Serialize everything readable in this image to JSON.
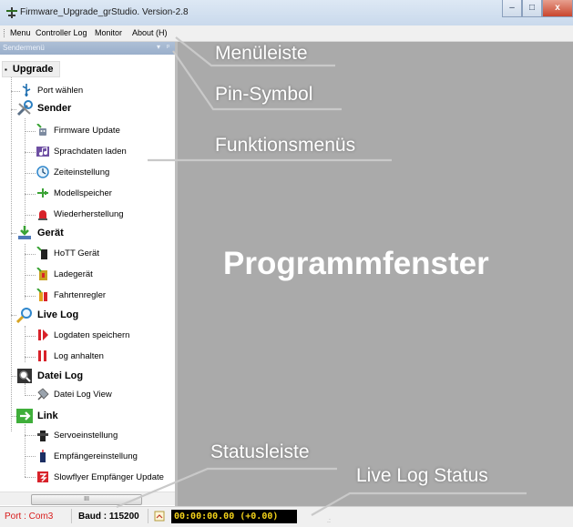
{
  "window": {
    "title": "Firmware_Upgrade_grStudio.  Version-2.8",
    "buttons": {
      "minimize": "‒",
      "maximize": "□",
      "close": "x"
    }
  },
  "menu": {
    "items": [
      "Menu",
      "Controller Log",
      "Monitor",
      "About (H)"
    ]
  },
  "panel": {
    "title": "Sendermenü",
    "dropdown_icon": "▾",
    "pin_icon": "ᵖ"
  },
  "tree": {
    "root": "Upgrade",
    "port": "Port wählen",
    "sender": {
      "label": "Sender",
      "children": [
        "Firmware Update",
        "Sprachdaten laden",
        "Zeiteinstellung",
        "Modellspeicher",
        "Wiederherstellung"
      ]
    },
    "geraet": {
      "label": "Gerät",
      "children": [
        "HoTT Gerät",
        "Ladegerät",
        "Fahrtenregler"
      ]
    },
    "livelog": {
      "label": "Live Log",
      "children": [
        "Logdaten speichern",
        "Log anhalten"
      ]
    },
    "dateilog": {
      "label": "Datei Log",
      "children": [
        "Datei Log View"
      ]
    },
    "link": {
      "label": "Link",
      "children": [
        "Servoeinstellung",
        "Empfängereinstellung",
        "Slowflyer Empfänger Update"
      ]
    }
  },
  "scrollbar": {
    "thumb_label": "III"
  },
  "statusbar": {
    "port": "Port : Com3",
    "baud": "Baud : 115200",
    "live_log": "00:00:00.00  (+0.00)",
    "grip": ".:"
  },
  "annotations": {
    "menubar": "Menüleiste",
    "pin": "Pin-Symbol",
    "functions": "Funktionsmenüs",
    "program": "Programmfenster",
    "statusbar": "Statusleiste",
    "livelog_status": "Live Log Status"
  },
  "colors": {
    "program_bg": "#aaaaaa",
    "port_text": "#d81b1b",
    "live_log_text": "#f3d21a"
  }
}
